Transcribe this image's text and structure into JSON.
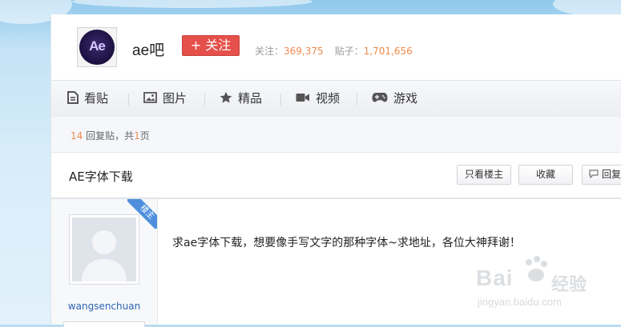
{
  "forum": {
    "logo_text": "Ae",
    "name": "ae吧",
    "follow_label": "+ 关注",
    "followers_label": "关注：",
    "followers_count": "369,375",
    "posts_label": "贴子：",
    "posts_count": "1,701,656"
  },
  "nav": {
    "items": [
      {
        "label": "看贴",
        "icon": "document-icon"
      },
      {
        "label": "图片",
        "icon": "image-icon"
      },
      {
        "label": "精品",
        "icon": "star-icon"
      },
      {
        "label": "视频",
        "icon": "video-icon"
      },
      {
        "label": "游戏",
        "icon": "gamepad-icon"
      }
    ]
  },
  "thread": {
    "reply_count": "14",
    "reply_text": " 回复贴，共",
    "page_count": "1",
    "page_suffix": "页",
    "title": "AE字体下载",
    "buttons": {
      "only_op": "只看楼主",
      "favorite": "收藏",
      "reply": "回复"
    }
  },
  "post": {
    "corner_badge": "楼主",
    "author": "wangsenchuan",
    "content": "求ae字体下载，想要像手写文字的那种字体~求地址，各位大神拜谢！"
  },
  "watermark": {
    "brand": "Bai",
    "brand_cn": "经验",
    "url": "jingyan.baidu.com"
  },
  "colors": {
    "follow_button": "#e5504a",
    "stat_number": "#f08a4b",
    "author_link": "#2d64b3",
    "corner_badge": "#4d8fdc"
  }
}
